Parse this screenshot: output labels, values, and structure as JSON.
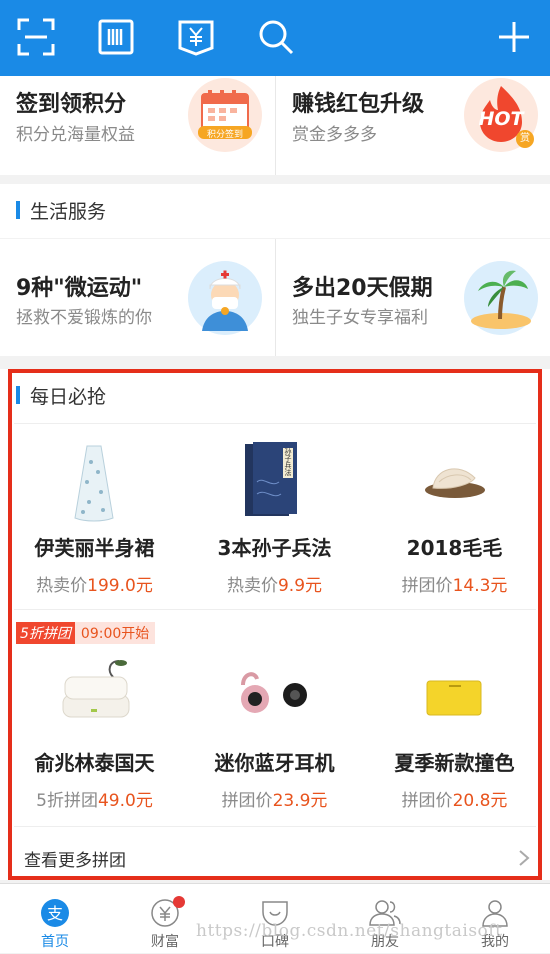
{
  "topbar": {
    "icons": [
      "scan-icon",
      "barcode-icon",
      "yuan-pay-icon",
      "search-icon",
      "plus-icon"
    ],
    "bg_color": "#1a8ae6"
  },
  "promos": [
    {
      "title": "签到领积分",
      "subtitle": "积分兑海量权益",
      "badge": "积分签到"
    },
    {
      "title": "赚钱红包升级",
      "subtitle": "赏金多多多",
      "badge": "HOT",
      "badge_sub": "赏"
    }
  ],
  "life_services": {
    "title": "生活服务",
    "items": [
      {
        "title": "9种\"微运动\"",
        "subtitle": "拯救不爱锻炼的你"
      },
      {
        "title": "多出20天假期",
        "subtitle": "独生子女专享福利"
      }
    ]
  },
  "daily": {
    "title": "每日必抢",
    "row1": [
      {
        "name": "伊芙丽半身裙",
        "price_label": "热卖价",
        "price": "199.0元"
      },
      {
        "name": "3本孙子兵法",
        "price_label": "热卖价",
        "price": "9.9元"
      },
      {
        "name": "2018毛毛",
        "price_label": "拼团价",
        "price": "14.3元"
      }
    ],
    "group_badge": "5折拼团",
    "group_time": "09:00开始",
    "row2": [
      {
        "name": "俞兆林泰国天",
        "price_label": "5折拼团",
        "price": "49.0元"
      },
      {
        "name": "迷你蓝牙耳机",
        "price_label": "拼团价",
        "price": "23.9元"
      },
      {
        "name": "夏季新款撞色",
        "price_label": "拼团价",
        "price": "20.8元"
      }
    ],
    "more_label": "查看更多拼团"
  },
  "book_cover_text": "孙子兵法",
  "tabs": [
    {
      "label": "首页",
      "icon": "alipay-home-icon",
      "active": true
    },
    {
      "label": "财富",
      "icon": "wealth-icon",
      "badge": true
    },
    {
      "label": "口碑",
      "icon": "koubei-icon"
    },
    {
      "label": "朋友",
      "icon": "friends-icon"
    },
    {
      "label": "我的",
      "icon": "profile-icon"
    }
  ],
  "watermark": "https://blog.csdn.net/shangtaisoft",
  "colors": {
    "accent": "#1a8ae6",
    "price": "#e8541e",
    "highlight_box": "#e52e1a"
  }
}
